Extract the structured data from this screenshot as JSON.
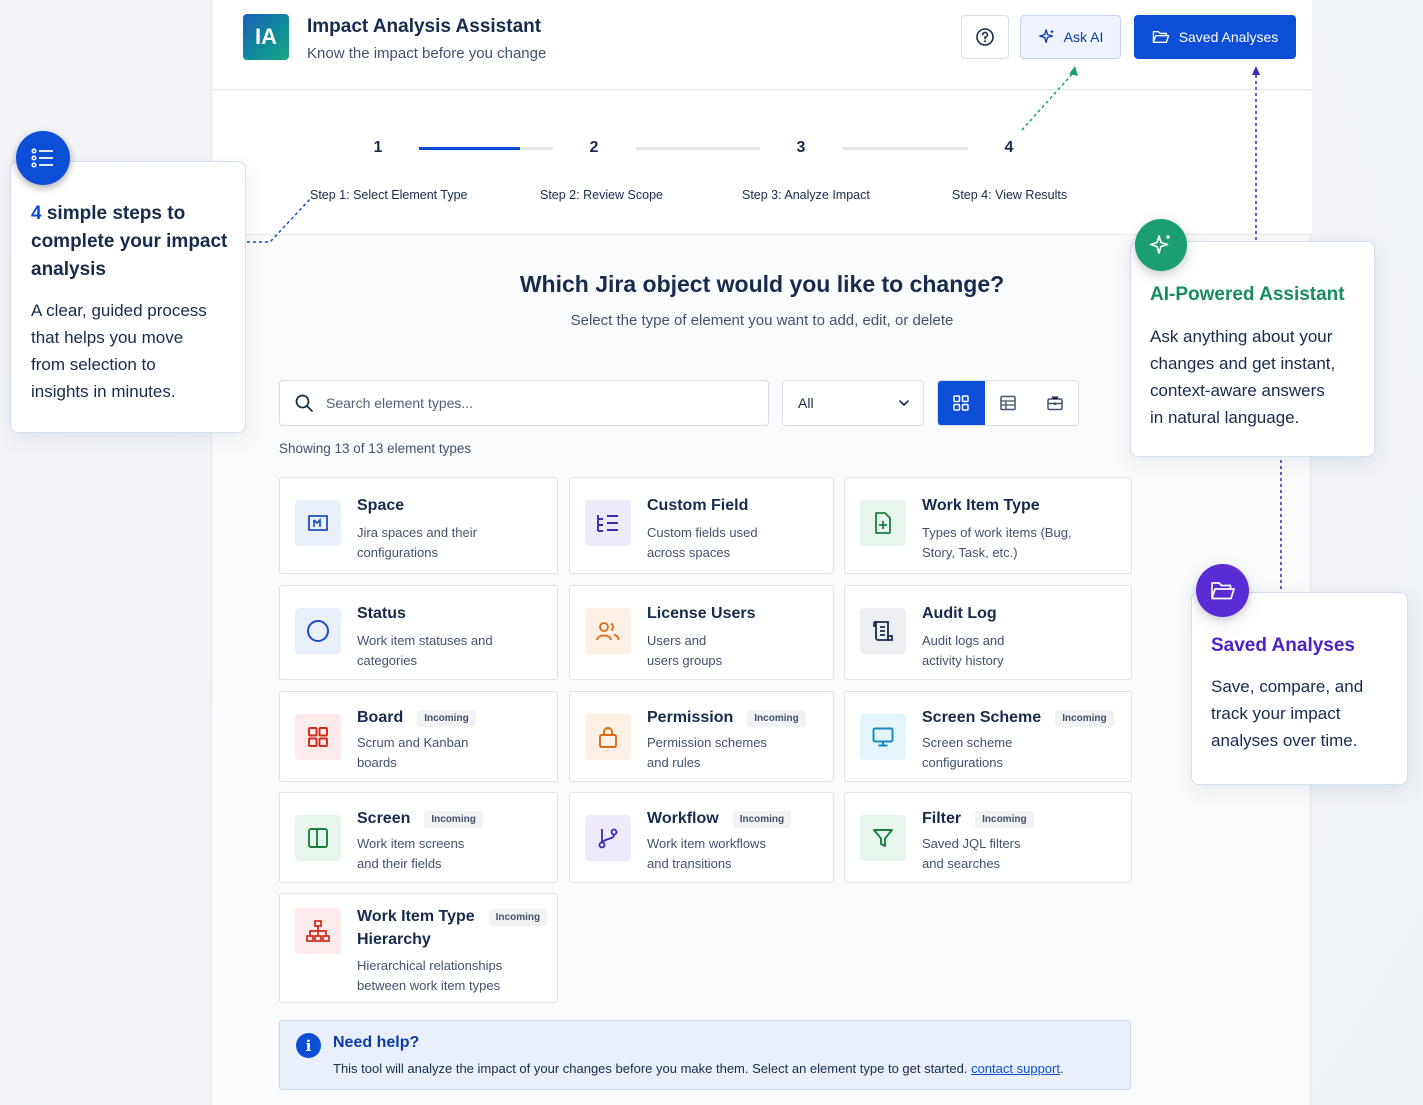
{
  "header": {
    "logo_text": "IA",
    "title": "Impact Analysis Assistant",
    "subtitle": "Know the impact before you change",
    "help_icon": "question-circle-icon",
    "ask_ai_label": "Ask AI",
    "saved_label": "Saved Analyses"
  },
  "stepper": {
    "steps": [
      {
        "number": "1",
        "label": "Step 1: Select Element Type",
        "state": "active"
      },
      {
        "number": "2",
        "label": "Step 2: Review Scope",
        "state": "todo"
      },
      {
        "number": "3",
        "label": "Step 3: Analyze Impact",
        "state": "todo"
      },
      {
        "number": "4",
        "label": "Step 4: View Results",
        "state": "todo"
      }
    ],
    "first_connector_progress": 0.75
  },
  "main": {
    "question": "Which Jira object would you like to change?",
    "question_sub": "Select the type of element you want to add, edit, or delete",
    "search_placeholder": "Search element types...",
    "filter_value": "All",
    "showing": "Showing 13 of 13 element types",
    "active_view": "grid"
  },
  "cards": [
    {
      "title": "Space",
      "desc1": "Jira spaces and their",
      "desc2": "configurations",
      "badge": "",
      "icon": "space-icon"
    },
    {
      "title": "Custom Field",
      "desc1": "Custom fields used",
      "desc2": "across spaces",
      "badge": "",
      "icon": "custom-field-icon"
    },
    {
      "title": "Work Item Type",
      "desc1": "Types of work items (Bug,",
      "desc2": "Story, Task, etc.)",
      "badge": "",
      "icon": "work-item-type-icon"
    },
    {
      "title": "Status",
      "desc1": "Work item statuses and",
      "desc2": "categories",
      "badge": "",
      "icon": "status-icon"
    },
    {
      "title": "License Users",
      "desc1": "Users and",
      "desc2": "users groups",
      "badge": "",
      "icon": "users-icon"
    },
    {
      "title": "Audit Log",
      "desc1": "Audit logs and",
      "desc2": "activity history",
      "badge": "",
      "icon": "audit-log-icon"
    },
    {
      "title": "Board",
      "desc1": "Scrum and Kanban",
      "desc2": "boards",
      "badge": "Incoming",
      "icon": "board-icon"
    },
    {
      "title": "Permission",
      "desc1": "Permission schemes",
      "desc2": "and rules",
      "badge": "Incoming",
      "icon": "lock-icon"
    },
    {
      "title": "Screen Scheme",
      "desc1": "Screen scheme",
      "desc2": "configurations",
      "badge": "Incoming",
      "icon": "monitor-icon"
    },
    {
      "title": "Screen",
      "desc1": "Work item screens",
      "desc2": "and their fields",
      "badge": "Incoming",
      "icon": "screen-icon"
    },
    {
      "title": "Workflow",
      "desc1": "Work item workflows",
      "desc2": "and transitions",
      "badge": "Incoming",
      "icon": "workflow-icon"
    },
    {
      "title": "Filter",
      "desc1": "Saved JQL filters",
      "desc2": "and searches",
      "badge": "Incoming",
      "icon": "filter-icon"
    },
    {
      "title": "Work Item Type",
      "title2": "Hierarchy",
      "desc1": "Hierarchical relationships",
      "desc2": "between work item types",
      "badge": "Incoming",
      "icon": "hierarchy-icon"
    }
  ],
  "help": {
    "title": "Need help?",
    "text": "This tool will analyze the impact of your changes before you make them. Select an element type to get started.",
    "link": "contact support",
    "trailing": "."
  },
  "callouts": {
    "steps": {
      "head_num": "4",
      "head_line1": " simple steps to",
      "head_line2": "complete your impact",
      "head_line3": "analysis",
      "body": [
        "A clear, guided process",
        "that helps you move",
        "from selection to",
        "insights in minutes."
      ],
      "icon": "list-icon"
    },
    "ai": {
      "head": "AI-Powered Assistant",
      "body": [
        "Ask anything about your",
        "changes and get instant,",
        "context-aware answers",
        "in natural language."
      ],
      "icon": "sparkle-icon"
    },
    "saved": {
      "head": "Saved Analyses",
      "body": [
        "Save, compare, and",
        "track your impact",
        "analyses over time."
      ],
      "icon": "folder-open-icon"
    }
  },
  "colors": {
    "primary": "#0c4fd6",
    "ai_green": "#1a9e72",
    "saved_purple": "#5b2bd6"
  }
}
